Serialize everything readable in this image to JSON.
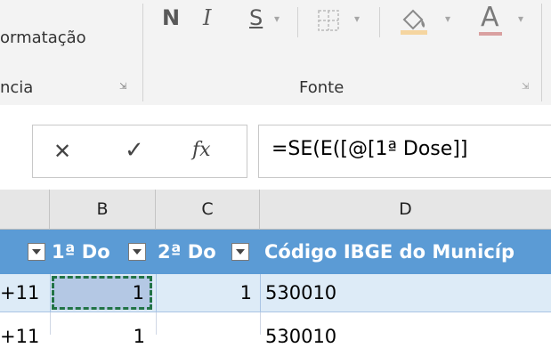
{
  "ribbon": {
    "formatting_fragment": "ormatação",
    "alignment_fragment": "ncia",
    "font_group_label": "Fonte",
    "bold_label": "N",
    "italic_label": "I",
    "underline_label": "S",
    "font_color_label": "A"
  },
  "formula_bar": {
    "cancel_symbol": "✕",
    "enter_symbol": "✓",
    "fx_label": "fx",
    "formula": "=SE(E([@[1ª Dose]]"
  },
  "columns": [
    "B",
    "C",
    "D"
  ],
  "table_headers": {
    "col_b": "1ª Do",
    "col_c": "2ª Do",
    "col_d": "Código IBGE do Municíp"
  },
  "rows": [
    {
      "a_fragment": "+11",
      "b": "1",
      "c": "1",
      "d": "530010"
    },
    {
      "a_fragment": "+11",
      "b": "1",
      "c": "",
      "d": "530010"
    }
  ],
  "colors": {
    "ribbon_bg": "#f3f3f3",
    "header_blue": "#5b9bd5",
    "row_band": "#ddebf7",
    "selected_cell": "#b4c8e4",
    "selection_border": "#217346"
  }
}
